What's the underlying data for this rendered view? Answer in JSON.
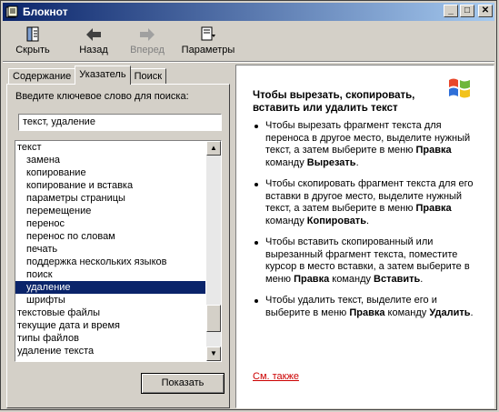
{
  "window": {
    "title": "Блокнот",
    "minimize_label": "_",
    "maximize_label": "□",
    "close_label": "✕"
  },
  "toolbar": {
    "hide_label": "Скрыть",
    "back_label": "Назад",
    "forward_label": "Вперед",
    "options_label": "Параметры"
  },
  "tabs": {
    "contents": "Содержание",
    "index": "Указатель",
    "search": "Поиск"
  },
  "index": {
    "prompt": "Введите ключевое слово для поиска:",
    "search_value": "текст, удаление",
    "show_button": "Показать",
    "items": [
      {
        "label": "текст",
        "level": 0
      },
      {
        "label": "замена",
        "level": 1
      },
      {
        "label": "копирование",
        "level": 1
      },
      {
        "label": "копирование и вставка",
        "level": 1
      },
      {
        "label": "параметры страницы",
        "level": 1
      },
      {
        "label": "перемещение",
        "level": 1
      },
      {
        "label": "перенос",
        "level": 1
      },
      {
        "label": "перенос по словам",
        "level": 1
      },
      {
        "label": "печать",
        "level": 1
      },
      {
        "label": "поддержка нескольких языков",
        "level": 1
      },
      {
        "label": "поиск",
        "level": 1
      },
      {
        "label": "удаление",
        "level": 1,
        "selected": true
      },
      {
        "label": "шрифты",
        "level": 1
      },
      {
        "label": "текстовые файлы",
        "level": 0
      },
      {
        "label": "текущие дата и время",
        "level": 0
      },
      {
        "label": "типы файлов",
        "level": 0
      },
      {
        "label": "удаление текста",
        "level": 0
      }
    ]
  },
  "topic": {
    "heading": "Чтобы вырезать, скопировать, вставить или удалить текст",
    "items": [
      {
        "pre": "Чтобы вырезать фрагмент текста для переноса в другое место, выделите нужный текст, а затем выберите в меню ",
        "b1": "Правка",
        "mid": " команду ",
        "b2": "Вырезать",
        "post": "."
      },
      {
        "pre": "Чтобы скопировать фрагмент текста для его вставки в другое место, выделите нужный текст, а затем выберите в меню ",
        "b1": "Правка",
        "mid": " команду ",
        "b2": "Копировать",
        "post": "."
      },
      {
        "pre": "Чтобы вставить скопированный или вырезанный фрагмент текста, поместите курсор в место вставки, а затем выберите в меню ",
        "b1": "Правка",
        "mid": " команду ",
        "b2": "Вставить",
        "post": "."
      },
      {
        "pre": "Чтобы удалить текст, выделите его и выберите в меню ",
        "b1": "Правка",
        "mid": " команду ",
        "b2": "Удалить",
        "post": "."
      }
    ],
    "see_also": "См. также"
  },
  "colors": {
    "titlebar_start": "#0a246a",
    "titlebar_end": "#a6caf0",
    "selection": "#0a246a",
    "link": "#cc0000",
    "face": "#d4d0c8"
  }
}
